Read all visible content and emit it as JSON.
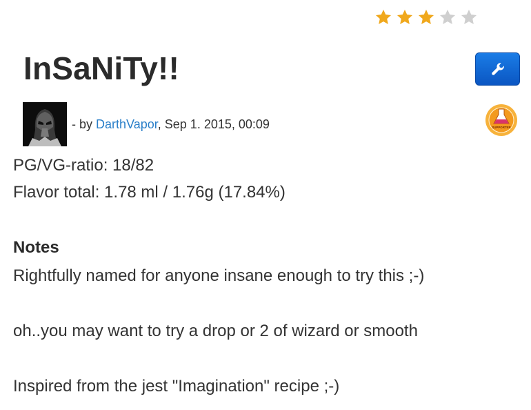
{
  "rating": {
    "value": 3,
    "max": 5,
    "filled_color": "#f0a81c",
    "empty_color": "#cfcfcf"
  },
  "recipe": {
    "title": "InSaNiTy!!",
    "author_prefix": "- by",
    "author": "DarthVapor",
    "date_sep": ",",
    "date": "Sep 1. 2015, 00:09",
    "pg_vg": "PG/VG-ratio: 18/82",
    "flavor_total": "Flavor total: 1.78 ml / 1.76g (17.84%)"
  },
  "edit_button": {
    "icon": "wrench-icon",
    "color": "#1466d6"
  },
  "supporter_badge": {
    "icon": "flask-icon",
    "text": "SUPPORTER",
    "color": "#f39a1e"
  },
  "notes": {
    "heading": "Notes",
    "lines": [
      "Rightfully named for anyone insane enough to try this ;-)",
      "oh..you may want to try a drop or 2 of wizard or smooth",
      "Inspired from the jest \"Imagination\" recipe ;-)"
    ]
  }
}
